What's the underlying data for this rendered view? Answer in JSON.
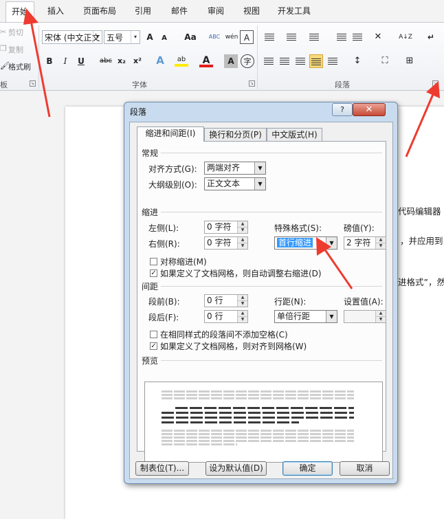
{
  "ribbon": {
    "tabs": [
      "开始",
      "插入",
      "页面布局",
      "引用",
      "邮件",
      "审阅",
      "视图",
      "开发工具"
    ],
    "clipboard": {
      "cut": "剪切",
      "copy": "复制",
      "painter": "格式刷",
      "group_fragment": "板"
    },
    "font": {
      "name": "宋体 (中文正文",
      "size": "五号",
      "group_label": "字体",
      "grow": "A",
      "shrink": "A",
      "case": "Aa",
      "clear": "ABC",
      "phonetic": "wén",
      "border": "A",
      "bold": "B",
      "italic": "I",
      "underline": "U",
      "strike": "abc",
      "sub": "x₂",
      "sup": "x²",
      "effect": "A",
      "highlight": "ab",
      "color": "A",
      "shade": "A",
      "enclose": "字"
    },
    "paragraph": {
      "group_label": "段落",
      "sort": "A↓Z",
      "marks": "↵"
    }
  },
  "document": {
    "fragments": [
      "代码编辑器",
      "，并应用到",
      "进格式”，然"
    ]
  },
  "dialog": {
    "title": "段落",
    "help": "?",
    "close": "✕",
    "tabs": [
      "缩进和间距(I)",
      "换行和分页(P)",
      "中文版式(H)"
    ],
    "general": {
      "section": "常规",
      "alignment_label": "对齐方式(G):",
      "alignment_value": "两端对齐",
      "outline_label": "大纲级别(O):",
      "outline_value": "正文文本"
    },
    "indent": {
      "section": "缩进",
      "left_label": "左侧(L):",
      "left_value": "0 字符",
      "right_label": "右侧(R):",
      "right_value": "0 字符",
      "special_label": "特殊格式(S):",
      "special_value": "首行缩进",
      "by_label": "磅值(Y):",
      "by_value": "2 字符",
      "mirror_label": "对称缩进(M)",
      "mirror_checked": false,
      "auto_right_label": "如果定义了文档网格，则自动调整右缩进(D)",
      "auto_right_checked": true
    },
    "spacing": {
      "section": "间距",
      "before_label": "段前(B):",
      "before_value": "0 行",
      "after_label": "段后(F):",
      "after_value": "0 行",
      "line_label": "行距(N):",
      "line_value": "单倍行距",
      "at_label": "设置值(A):",
      "at_value": "",
      "no_space_label": "在相同样式的段落间不添加空格(C)",
      "no_space_checked": false,
      "snap_label": "如果定义了文档网格，则对齐到网格(W)",
      "snap_checked": true
    },
    "preview": {
      "section": "预览"
    },
    "buttons": {
      "tabs": "制表位(T)...",
      "default": "设为默认值(D)",
      "ok": "确定",
      "cancel": "取消"
    }
  },
  "colors": {
    "arrow": "#ee3b2f",
    "selection": "#3399ff",
    "accent": "#f8d978"
  }
}
